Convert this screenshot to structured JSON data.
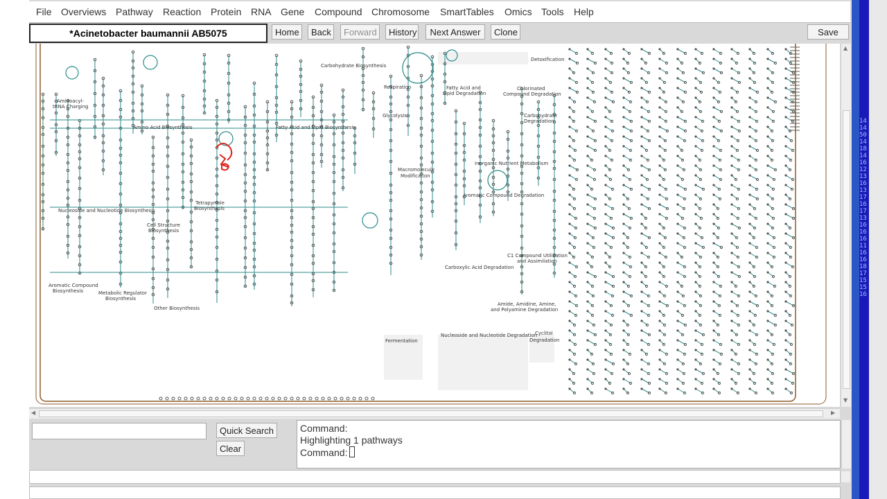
{
  "menu": [
    "File",
    "Overviews",
    "Pathway",
    "Reaction",
    "Protein",
    "RNA",
    "Gene",
    "Compound",
    "Chromosome",
    "SmartTables",
    "Omics",
    "Tools",
    "Help"
  ],
  "organism": "*Acinetobacter baumannii AB5075",
  "toolbar": {
    "home": "Home",
    "back": "Back",
    "forward": "Forward",
    "history": "History",
    "next_answer": "Next Answer",
    "clone": "Clone",
    "save_db": "Save DB"
  },
  "overview_labels": [
    "Carbohydrate Biosynthesis",
    "Respiration",
    "Glycolysis",
    "Fatty Acid and",
    "Lipid Degradation",
    "Detoxification",
    "Chlorinated",
    "Compound Degradation",
    "Carbohydrate",
    "Degradation",
    "Aminoacyl-",
    "tRNA Charging",
    "Amino Acid Biosynthesis",
    "Fatty Acid and Lipid Biosynthesis",
    "Macromolecule",
    "Modification",
    "Inorganic Nutrient Metabolism",
    "Aromatic Compound Degradation",
    "Tetrapyrrole",
    "Biosynthesis",
    "Nucleoside and Nucleotide Biosynthesis",
    "Cell Structure",
    "Biosynthesis",
    "C1 Compound Utilization",
    "and Assimilation",
    "Carboxylic Acid Degradation",
    "Aromatic Compound",
    "Biosynthesis",
    "Metabolic Regulator",
    "Biosynthesis",
    "Amide, Amidine, Amine,",
    "and Polyamine Degradation",
    "Other Biosynthesis",
    "Fermentation",
    "Nucleoside and Nucleotide Degradation",
    "Cyclitol",
    "Degradation"
  ],
  "search": {
    "placeholder": "",
    "quick_search": "Quick Search",
    "clear": "Clear"
  },
  "console": {
    "line1": "Command:",
    "line2": "Highlighting 1 pathways",
    "line3": "Command:"
  },
  "side_numbers": [
    "14",
    "14",
    "50",
    "14",
    "18",
    "14",
    "16",
    "12",
    "13",
    "16",
    "13",
    "17",
    "16",
    "17",
    "13",
    "16",
    "16",
    "16",
    "11",
    "16",
    "16",
    "18",
    "17",
    "15",
    "15",
    "16"
  ],
  "colors": {
    "pathway": "#2b8a8a",
    "node": "#555555",
    "highlight": "#e0201b",
    "cell_border": "#8b5a2b",
    "panel": "#d9d9d9"
  }
}
